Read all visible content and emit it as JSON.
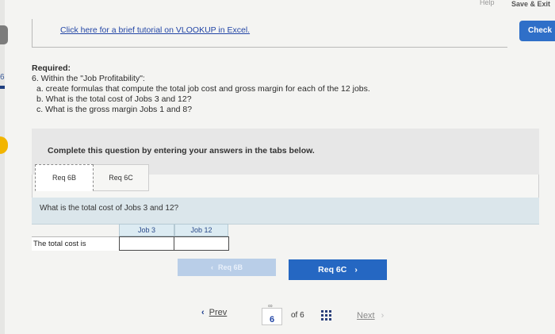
{
  "header": {
    "help_label": "Help",
    "save_exit_label": "Save & Exit",
    "check_label": "Check"
  },
  "sidebar": {
    "question_number": "6"
  },
  "tutorial": {
    "link_text": "Click here for a brief tutorial on VLOOKUP in Excel."
  },
  "required": {
    "title": "Required:",
    "item": "6. Within the \"Job Profitability\":",
    "a": "a. create formulas that compute the total job cost and gross margin for each of the 12 jobs.",
    "b": "b. What is the total cost of Jobs 3 and 12?",
    "c": "c. What is the gross margin Jobs 1 and 8?"
  },
  "instructions": "Complete this question by entering your answers in the tabs below.",
  "tabs": [
    {
      "label": "Req 6B",
      "active": true
    },
    {
      "label": "Req 6C",
      "active": false
    }
  ],
  "prompt": "What is the total cost of Jobs 3 and 12?",
  "table": {
    "columns": [
      "Job 3",
      "Job 12"
    ],
    "row_label": "The total cost is",
    "values": [
      "",
      ""
    ]
  },
  "nav": {
    "prev_tab_label": "Req 6B",
    "next_tab_label": "Req 6C"
  },
  "pager": {
    "prev_label": "Prev",
    "current_page": "6",
    "of_label": "of 6",
    "next_label": "Next"
  },
  "colors": {
    "accent": "#2567c2",
    "disabled_accent": "#b9cee8",
    "link": "#2346a6",
    "highlight_yellow": "#f2b500"
  }
}
